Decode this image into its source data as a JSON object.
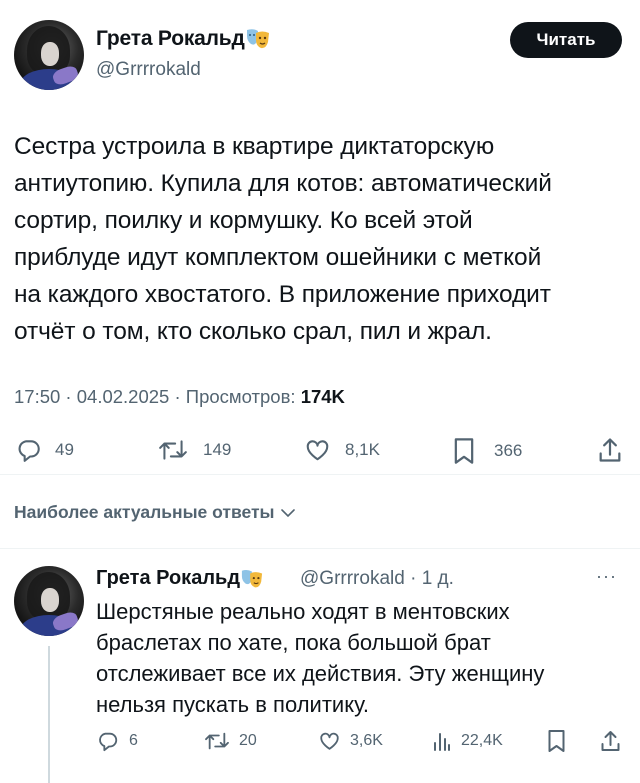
{
  "tweet": {
    "author_name": "Грета Рокальд",
    "author_handle": "@Grrrrokald",
    "follow_label": "Читать",
    "text": "Сестра устроила в квартире диктаторскую\nантиутопию. Купила для котов: автоматический\nсортир, поилку и кормушку. Ко всей этой\nприблуде идут комплектом ошейники с меткой\nна каждого хвостатого. В приложение приходит\nотчёт о том, кто сколько срал, пил и жрал.",
    "time": "17:50",
    "date": "04.02.2025",
    "views_label": "Просмотров:",
    "views": "174K",
    "replies": "49",
    "retweets": "149",
    "likes": "8,1K",
    "bookmarks": "366",
    "icons": [
      "reply-icon",
      "retweet-icon",
      "like-icon",
      "bookmark-icon",
      "share-icon",
      "mask-icon"
    ]
  },
  "sort_label": "Наиболее актуальные ответы",
  "reply": {
    "author_name": "Грета Рокальд",
    "author_handle": "@Grrrrokald",
    "age": "1 д.",
    "text": "Шерстяные реально ходят в ментовских\nбраслетах по хате, пока большой брат\nотслеживает все их действия. Эту женщину\nнельзя пускать в политику.",
    "replies": "6",
    "retweets": "20",
    "likes": "3,6K",
    "views": "22,4K",
    "icons": [
      "reply-icon",
      "retweet-icon",
      "like-icon",
      "views-icon",
      "bookmark-icon",
      "share-icon",
      "more-icon"
    ]
  },
  "colors": {
    "text": "#0f1419",
    "secondary": "#536471",
    "button_bg": "#0f1419",
    "divider": "#eff3f4"
  }
}
